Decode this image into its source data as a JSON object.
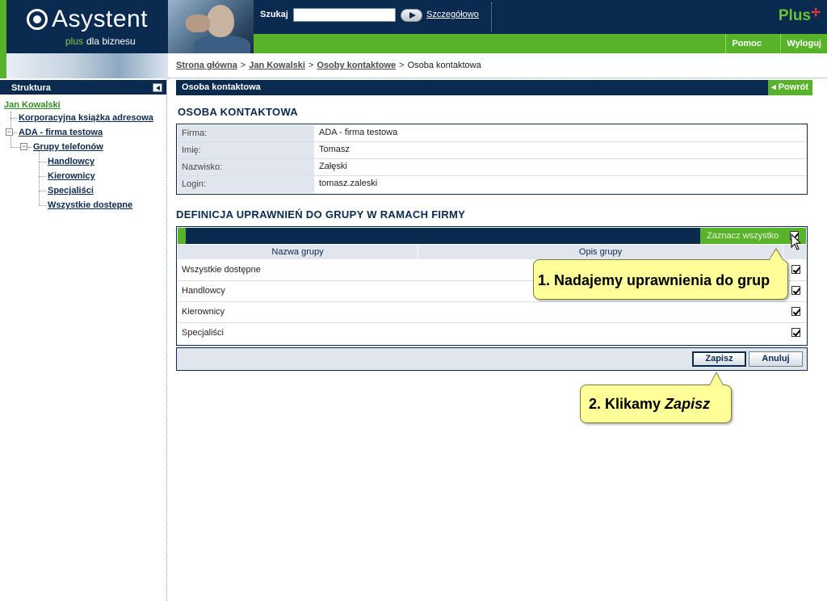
{
  "header": {
    "logo_title": "Asystent",
    "logo_plus": "plus",
    "logo_sub": "dla biznesu",
    "brand": "Plus",
    "search_label": "Szukaj",
    "search_value": "",
    "search_advanced": "Szczegółowo",
    "nav": {
      "help": "Pomoc",
      "logout": "Wyloguj"
    }
  },
  "sidebar": {
    "title": "Struktura",
    "tree": {
      "root": "Jan Kowalski",
      "address_book": "Korporacyjna książka adresowa",
      "company": "ADA - firma testowa",
      "phone_groups": "Grupy telefonów",
      "groups": [
        "Handlowcy",
        "Kierownicy",
        "Specjaliści",
        "Wszystkie dostepne"
      ]
    }
  },
  "breadcrumb": {
    "items": [
      "Strona główna",
      "Jan Kowalski",
      "Osoby kontaktowe"
    ],
    "current": "Osoba kontaktowa",
    "separator": ">"
  },
  "section": {
    "title": "Osoba kontaktowa",
    "back_label": "◂ Powrót"
  },
  "person": {
    "heading": "OSOBA KONTAKTOWA",
    "rows": [
      {
        "label": "Firma:",
        "value": "ADA - firma testowa"
      },
      {
        "label": "Imię:",
        "value": "Tomasz"
      },
      {
        "label": "Nazwisko:",
        "value": "Załęski"
      },
      {
        "label": "Login:",
        "value": "tomasz.zaleski"
      }
    ]
  },
  "permissions": {
    "heading": "DEFINICJA UPRAWNIEŃ DO GRUPY W RAMACH FIRMY",
    "select_all": "Zaznacz wszystko",
    "select_all_checked": true,
    "columns": {
      "name": "Nazwa grupy",
      "description": "Opis grupy"
    },
    "rows": [
      {
        "name": "Wszystkie dostępne",
        "description": "",
        "checked": true
      },
      {
        "name": "Handlowcy",
        "description": "",
        "checked": true
      },
      {
        "name": "Kierownicy",
        "description": "",
        "checked": true
      },
      {
        "name": "Specjaliści",
        "description": "",
        "checked": true
      }
    ]
  },
  "actions": {
    "save": "Zapisz",
    "cancel": "Anuluj"
  },
  "callouts": {
    "step1": "1. Nadajemy uprawnienia do grup",
    "step2_prefix": "2. Klikamy ",
    "step2_emph": "Zapisz"
  },
  "colors": {
    "navy": "#0b2a4f",
    "green": "#58b32a",
    "light_gray": "#e1e6ed",
    "callout_yellow": "#ffff99"
  }
}
